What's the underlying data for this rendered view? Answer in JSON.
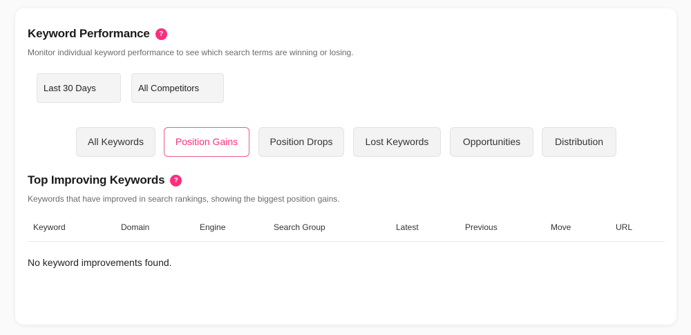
{
  "header": {
    "title": "Keyword Performance",
    "help_icon": "?",
    "description": "Monitor individual keyword performance to see which search terms are winning or losing."
  },
  "filters": {
    "date_range": "Last 30 Days",
    "competitors": "All Competitors"
  },
  "tabs": [
    {
      "label": "All Keywords"
    },
    {
      "label": "Position Gains"
    },
    {
      "label": "Position Drops"
    },
    {
      "label": "Lost Keywords"
    },
    {
      "label": "Opportunities"
    },
    {
      "label": "Distribution"
    }
  ],
  "section": {
    "title": "Top Improving Keywords",
    "help_icon": "?",
    "description": "Keywords that have improved in search rankings, showing the biggest position gains."
  },
  "table": {
    "columns": [
      "Keyword",
      "Domain",
      "Engine",
      "Search Group",
      "Latest",
      "Previous",
      "Move",
      "URL"
    ],
    "empty_message": "No keyword improvements found."
  },
  "colors": {
    "accent": "#fd2d7e"
  }
}
